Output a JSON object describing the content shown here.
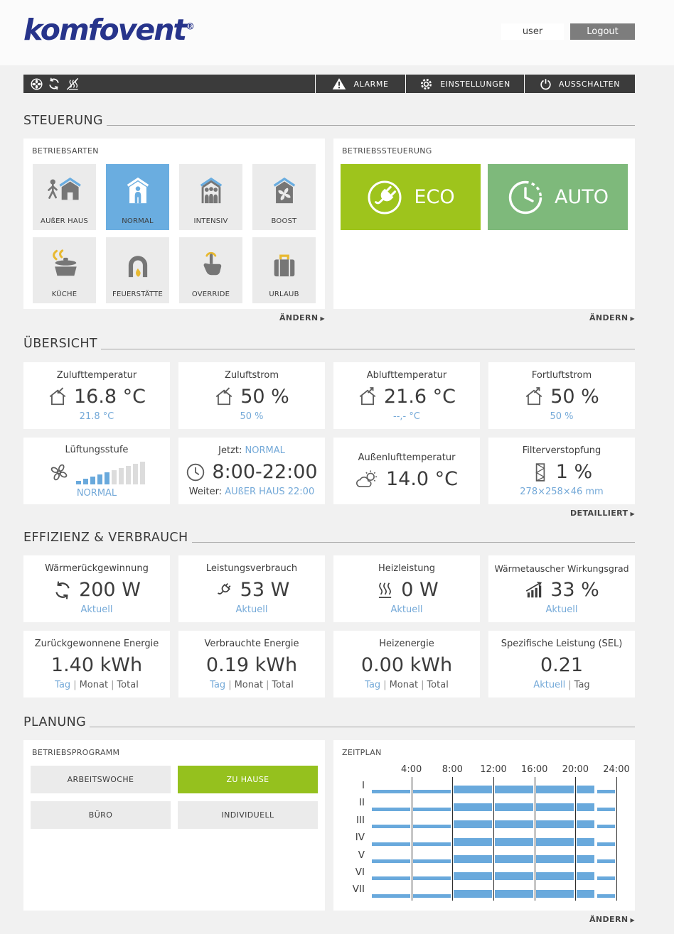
{
  "header": {
    "logo_text": "komfovent",
    "logo_mark": "®",
    "username": "user",
    "logout_label": "Logout"
  },
  "navbar": {
    "status_icons": [
      "fan-icon",
      "rotor-icon",
      "heater-off-icon"
    ],
    "alarms_label": "ALARME",
    "settings_label": "EINSTELLUNGEN",
    "power_label": "AUSSCHALTEN"
  },
  "icons": {
    "arrow_right": "▶"
  },
  "steuerung": {
    "title": "STEUERUNG",
    "betriebsarten": {
      "label": "BETRIEBSARTEN",
      "aendern_label": "ÄNDERN",
      "modes": [
        {
          "label": "AUßER HAUS",
          "icon": "away-icon",
          "selected": false
        },
        {
          "label": "NORMAL",
          "icon": "home-person-icon",
          "selected": true
        },
        {
          "label": "INTENSIV",
          "icon": "intensive-icon",
          "selected": false
        },
        {
          "label": "BOOST",
          "icon": "boost-icon",
          "selected": false
        },
        {
          "label": "KÜCHE",
          "icon": "kitchen-icon",
          "selected": false
        },
        {
          "label": "FEUERSTÄTTE",
          "icon": "fireplace-icon",
          "selected": false
        },
        {
          "label": "OVERRIDE",
          "icon": "override-icon",
          "selected": false
        },
        {
          "label": "URLAUB",
          "icon": "suitcase-icon",
          "selected": false
        }
      ]
    },
    "betriebssteuerung": {
      "label": "BETRIEBSSTEUERUNG",
      "aendern_label": "ÄNDERN",
      "eco_label": "ECO",
      "auto_label": "AUTO"
    }
  },
  "uebersicht": {
    "title": "ÜBERSICHT",
    "detailliert_label": "DETAILLIERT",
    "tiles": [
      {
        "title": "Zulufttemperatur",
        "value": "16.8 °C",
        "sub": "21.8 °C"
      },
      {
        "title": "Zuluftstrom",
        "value": "50 %",
        "sub": "50 %"
      },
      {
        "title": "Ablufttemperatur",
        "value": "21.6 °C",
        "sub": "--,- °C"
      },
      {
        "title": "Fortluftstrom",
        "value": "50 %",
        "sub": "50 %"
      }
    ],
    "luftungsstufe": {
      "title": "Lüftungsstufe",
      "sub": "NORMAL",
      "level": 5,
      "bars_total": 10
    },
    "zeitfenster": {
      "now_label": "Jetzt:",
      "now_mode": "NORMAL",
      "value": "8:00-22:00",
      "next_label": "Weiter:",
      "next_value": "AUßER HAUS 22:00"
    },
    "aussenluft": {
      "title": "Außenlufttemperatur",
      "value": "14.0 °C"
    },
    "filter": {
      "title": "Filterverstopfung",
      "value": "1 %",
      "sub": "278×258×46 mm"
    }
  },
  "effizienz": {
    "title": "EFFIZIENZ & VERBRAUCH",
    "separator": "|",
    "row1": [
      {
        "title": "Wärmerückgewinnung",
        "value": "200 W",
        "sub": "Aktuell"
      },
      {
        "title": "Leistungsverbrauch",
        "value": "53 W",
        "sub": "Aktuell"
      },
      {
        "title": "Heizleistung",
        "value": "0 W",
        "sub": "Aktuell"
      },
      {
        "title": "Wärmetauscher Wirkungsgrad",
        "value": "33 %",
        "sub": "Aktuell"
      }
    ],
    "row2": [
      {
        "title": "Zurückgewonnene Energie",
        "value": "1.40 kWh",
        "links": [
          "Tag",
          "Monat",
          "Total"
        ]
      },
      {
        "title": "Verbrauchte Energie",
        "value": "0.19 kWh",
        "links": [
          "Tag",
          "Monat",
          "Total"
        ]
      },
      {
        "title": "Heizenergie",
        "value": "0.00 kWh",
        "links": [
          "Tag",
          "Monat",
          "Total"
        ]
      },
      {
        "title": "Spezifische Leistung (SEL)",
        "value": "0.21",
        "links": [
          "Aktuell",
          "Tag"
        ]
      }
    ]
  },
  "planung": {
    "title": "PLANUNG",
    "aendern_label": "ÄNDERN",
    "betriebsprogramm": {
      "label": "BETRIEBSPROGRAMM",
      "programs": [
        {
          "label": "ARBEITSWOCHE",
          "selected": false
        },
        {
          "label": "ZU HAUSE",
          "selected": true
        },
        {
          "label": "BÜRO",
          "selected": false
        },
        {
          "label": "INDIVIDUELL",
          "selected": false
        }
      ]
    },
    "zeitplan_label": "ZEITPLAN"
  },
  "chart_data": {
    "type": "schedule-gantt",
    "title": "ZEITPLAN",
    "x_ticks": [
      "4:00",
      "8:00",
      "12:00",
      "16:00",
      "20:00",
      "24:00"
    ],
    "x_range_hours": [
      0,
      24
    ],
    "rows": [
      "I",
      "II",
      "III",
      "IV",
      "V",
      "VI",
      "VII"
    ],
    "segments_per_row": [
      {
        "from": 0,
        "to": 8,
        "level": "low"
      },
      {
        "from": 8,
        "to": 22,
        "level": "high"
      },
      {
        "from": 22,
        "to": 24,
        "level": "low"
      }
    ],
    "bar_color": "#69a9dc",
    "gridline_color": "#2e2e2e"
  },
  "colors": {
    "accent_blue": "#6aade0",
    "link_blue": "#74a9d8",
    "eco_green": "#9ec41c",
    "auto_green": "#7eb97b",
    "program_green": "#95c11e",
    "navbar_dark": "#3b3b3b",
    "logo_blue": "#27348b"
  }
}
